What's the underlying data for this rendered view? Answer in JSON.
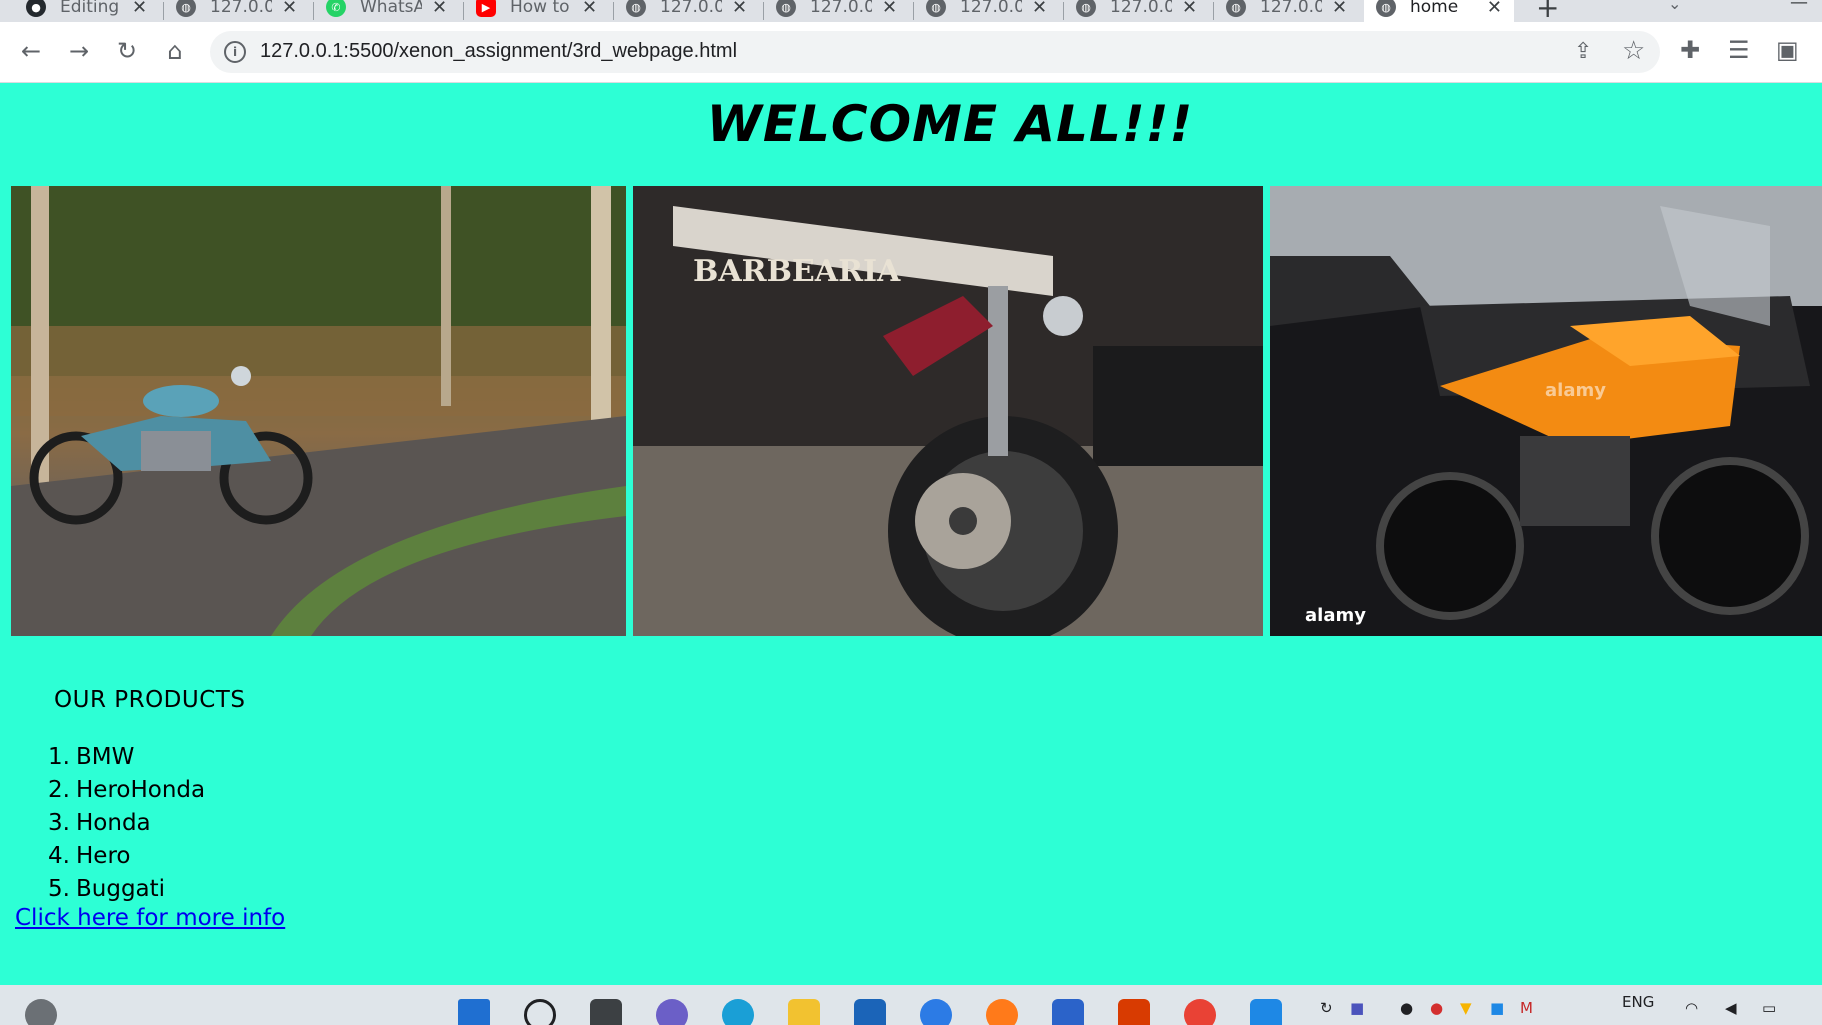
{
  "browser": {
    "tabs": [
      {
        "title": "Editing",
        "favicon": "github-icon",
        "active": false
      },
      {
        "title": "127.0.0",
        "favicon": "globe-icon",
        "active": false
      },
      {
        "title": "WhatsA",
        "favicon": "whatsapp-icon",
        "active": false
      },
      {
        "title": "How to",
        "favicon": "youtube-icon",
        "active": false
      },
      {
        "title": "127.0.0",
        "favicon": "globe-icon",
        "active": false
      },
      {
        "title": "127.0.0",
        "favicon": "globe-icon",
        "active": false
      },
      {
        "title": "127.0.0",
        "favicon": "globe-icon",
        "active": false
      },
      {
        "title": "127.0.0",
        "favicon": "globe-icon",
        "active": false
      },
      {
        "title": "127.0.0",
        "favicon": "globe-icon",
        "active": false
      },
      {
        "title": "home",
        "favicon": "globe-icon",
        "active": true
      }
    ],
    "address": {
      "url": "127.0.0.1:5500/xenon_assignment/3rd_webpage.html"
    }
  },
  "page": {
    "heading": "WELCOME ALL!!!",
    "images": [
      {
        "name": "royal-enfield-motorcycle-photo",
        "watermark": ""
      },
      {
        "name": "cruiser-motorcycle-barbearia-photo",
        "watermark": "BARBEARIA"
      },
      {
        "name": "ktm-orange-motorcycle-photo",
        "watermark": "alamy"
      }
    ],
    "products_title": "OUR PRODUCTS",
    "products": [
      {
        "num": "1.",
        "name": "BMW"
      },
      {
        "num": "2.",
        "name": "HeroHonda"
      },
      {
        "num": "3.",
        "name": "Honda"
      },
      {
        "num": "4.",
        "name": "Hero"
      },
      {
        "num": "5.",
        "name": "Buggati"
      }
    ],
    "link_text": "Click here for more info"
  },
  "taskbar": {
    "language": "ENG"
  }
}
